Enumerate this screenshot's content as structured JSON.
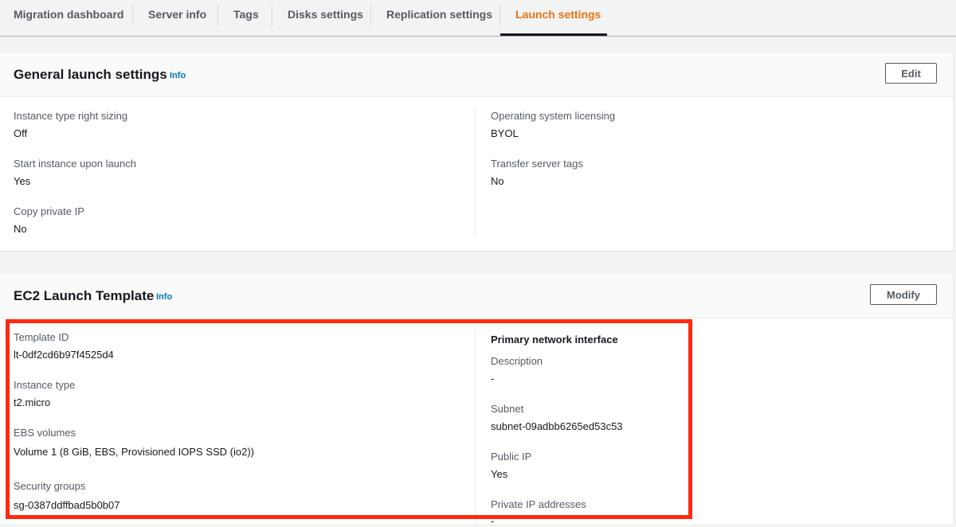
{
  "tabs": [
    {
      "label": "Migration dashboard"
    },
    {
      "label": "Server info"
    },
    {
      "label": "Tags"
    },
    {
      "label": "Disks settings"
    },
    {
      "label": "Replication settings"
    },
    {
      "label": "Launch settings",
      "active": true
    }
  ],
  "general": {
    "title": "General launch settings",
    "info": "Info",
    "edit_label": "Edit",
    "left": [
      {
        "label": "Instance type right sizing",
        "value": "Off"
      },
      {
        "label": "Start instance upon launch",
        "value": "Yes"
      },
      {
        "label": "Copy private IP",
        "value": "No"
      }
    ],
    "right": [
      {
        "label": "Operating system licensing",
        "value": "BYOL"
      },
      {
        "label": "Transfer server tags",
        "value": "No"
      }
    ]
  },
  "ec2": {
    "title": "EC2 Launch Template",
    "info": "Info",
    "modify_label": "Modify",
    "left": [
      {
        "label": "Template ID",
        "value": "lt-0df2cd6b97f4525d4"
      },
      {
        "label": "Instance type",
        "value": "t2.micro"
      },
      {
        "label": "EBS volumes",
        "value": "Volume 1 (8 GiB, EBS, Provisioned IOPS SSD (io2))"
      },
      {
        "label": "Security groups",
        "value": "sg-0387ddffbad5b0b07"
      }
    ],
    "network": {
      "heading": "Primary network interface",
      "fields": [
        {
          "label": "Description",
          "value": "-"
        },
        {
          "label": "Subnet",
          "value": "subnet-09adbb6265ed53c53"
        },
        {
          "label": "Public IP",
          "value": "Yes"
        },
        {
          "label": "Private IP addresses",
          "value": "-"
        }
      ]
    }
  },
  "colors": {
    "accent": "#ec7211",
    "link": "#0073bb",
    "highlight": "#ff2a10"
  }
}
